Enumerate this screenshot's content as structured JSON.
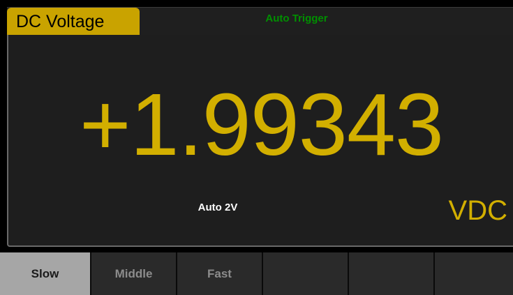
{
  "header": {
    "mode_label": "DC Voltage",
    "trigger_label": "Auto Trigger"
  },
  "display": {
    "reading": "+1.99343",
    "range_label": "Auto  2V",
    "unit": "VDC"
  },
  "softkeys": [
    {
      "label": "Slow",
      "active": true
    },
    {
      "label": "Middle",
      "active": false
    },
    {
      "label": "Fast",
      "active": false
    },
    {
      "label": "",
      "active": false
    },
    {
      "label": "",
      "active": false
    },
    {
      "label": "",
      "active": false
    }
  ],
  "colors": {
    "accent_yellow": "#d2af00",
    "tab_yellow": "#c9a300",
    "trigger_green": "#008f00",
    "panel_bg": "#1e1e1e"
  }
}
